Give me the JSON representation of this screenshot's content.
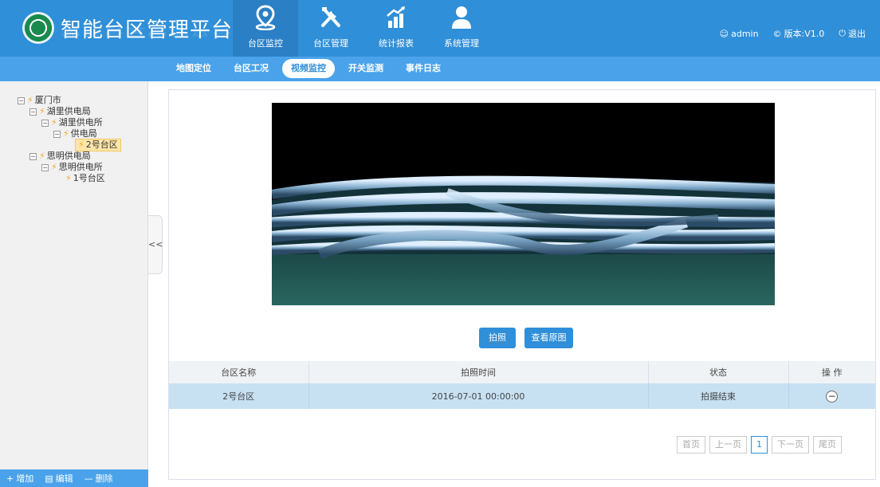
{
  "header": {
    "app_title": "智能台区管理平台",
    "nav": [
      {
        "label": "台区监控",
        "icon": "location-pin-icon",
        "active": true
      },
      {
        "label": "台区管理",
        "icon": "tools-icon",
        "active": false
      },
      {
        "label": "统计报表",
        "icon": "chart-icon",
        "active": false
      },
      {
        "label": "系统管理",
        "icon": "user-icon",
        "active": false
      }
    ],
    "user": "admin",
    "version": "版本:V1.0",
    "logout": "退出"
  },
  "subnav": {
    "tabs": [
      "地图定位",
      "台区工况",
      "视频监控",
      "开关监测",
      "事件日志"
    ],
    "active": "视频监控"
  },
  "tree": {
    "nodes": [
      {
        "label": "厦门市"
      },
      {
        "label": "湖里供电局"
      },
      {
        "label": "湖里供电所"
      },
      {
        "label": "供电局"
      },
      {
        "label": "2号台区",
        "selected": true
      },
      {
        "label": "思明供电局"
      },
      {
        "label": "思明供电所"
      },
      {
        "label": "1号台区"
      }
    ]
  },
  "sidebar": {
    "collapse_label": "<<",
    "toolbar": {
      "add": "增加",
      "edit": "编辑",
      "delete": "删除"
    }
  },
  "video_panel": {
    "snapshot_button": "拍照",
    "view_original_button": "查看原图"
  },
  "records_table": {
    "headers": [
      "台区名称",
      "拍照时间",
      "状态",
      "操 作"
    ],
    "rows": [
      {
        "name": "2号台区",
        "time": "2016-07-01 00:00:00",
        "status": "拍摄结束"
      }
    ]
  },
  "pagination": {
    "first": "首页",
    "prev": "上一页",
    "current": "1",
    "next": "下一页",
    "last": "尾页"
  },
  "colors": {
    "header_bg": "#2f8fd8",
    "subnav_bg": "#4aa3ea",
    "selected_row": "#c7e1f3",
    "tree_bolt": "#f5a623"
  }
}
